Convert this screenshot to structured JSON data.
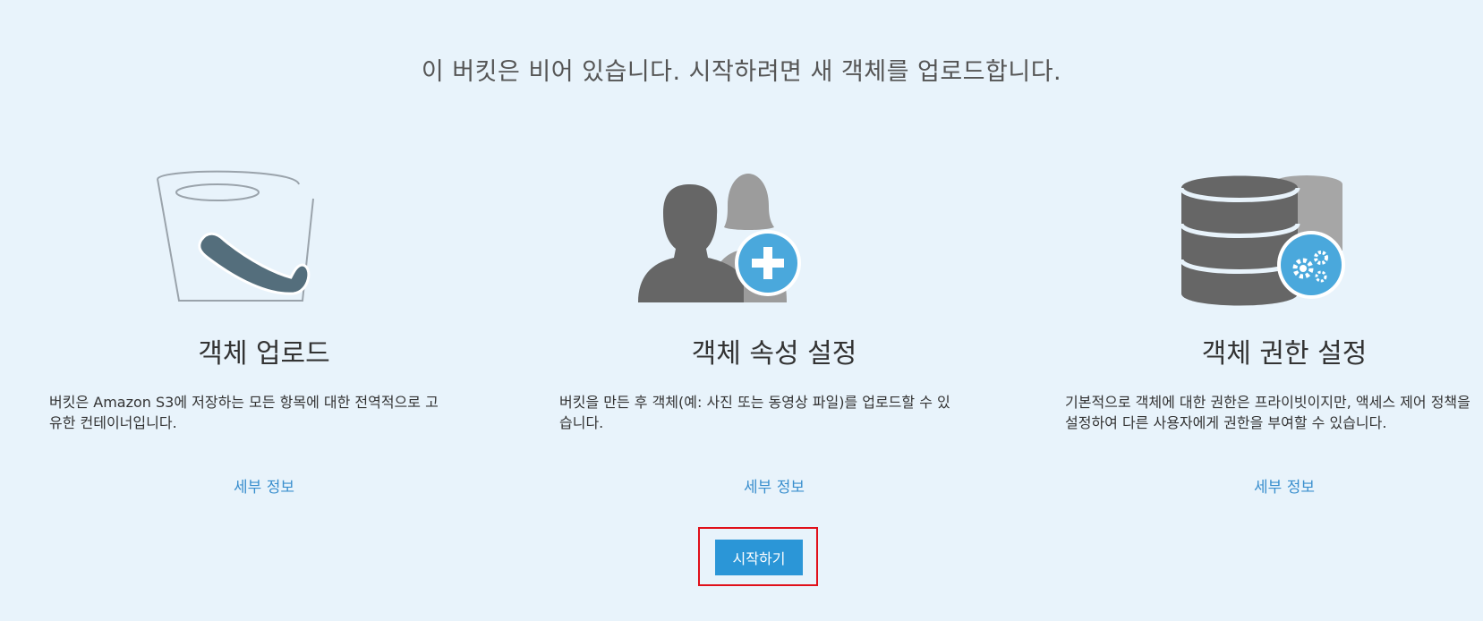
{
  "headline": "이 버킷은 비어 있습니다. 시작하려면 새 객체를 업로드합니다.",
  "columns": [
    {
      "icon": "bucket-icon",
      "title": "객체 업로드",
      "description": "버킷은 Amazon S3에 저장하는 모든 항목에 대한 전역적으로 고유한 컨테이너입니다.",
      "link": "세부 정보"
    },
    {
      "icon": "users-add-icon",
      "title": "객체 속성 설정",
      "description": "버킷을 만든 후 객체(예: 사진 또는 동영상 파일)를 업로드할 수 있습니다.",
      "link": "세부 정보"
    },
    {
      "icon": "database-settings-icon",
      "title": "객체 권한 설정",
      "description": "기본적으로 객체에 대한 권한은 프라이빗이지만, 액세스 제어 정책을 설정하여 다른 사용자에게 권한을 부여할 수 있습니다.",
      "link": "세부 정보"
    }
  ],
  "start_button": "시작하기",
  "colors": {
    "background": "#e8f3fb",
    "link": "#3a8fce",
    "button": "#2b96d7",
    "highlight_border": "#e0101a",
    "icon_gray": "#666666",
    "icon_accent": "#4aa8dc"
  }
}
